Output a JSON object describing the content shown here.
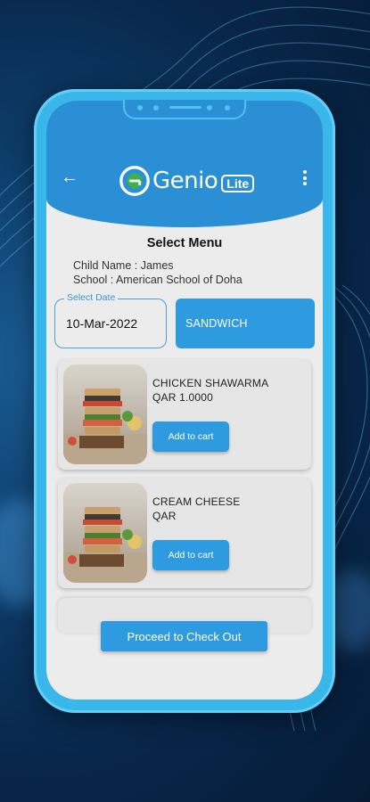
{
  "header": {
    "logo_text": "Genio",
    "logo_badge": "Lite",
    "back_icon": "arrow-left-icon",
    "menu_icon": "more-vertical-icon"
  },
  "page": {
    "title": "Select Menu",
    "child_name": "Child Name : James",
    "school": "School : American School of Doha"
  },
  "filters": {
    "date_label": "Select Date",
    "date_value": "10-Mar-2022",
    "category": "SANDWICH"
  },
  "items": [
    {
      "name": "CHICKEN SHAWARMA",
      "price": "QAR 1.0000",
      "button": "Add to cart"
    },
    {
      "name": "CREAM CHEESE",
      "price": "QAR",
      "button": "Add to cart"
    }
  ],
  "checkout_label": "Proceed to Check Out",
  "colors": {
    "primary": "#2e9ae0",
    "header": "#2b8fd6",
    "frame": "#3ab7ea",
    "background": "#08264a"
  }
}
